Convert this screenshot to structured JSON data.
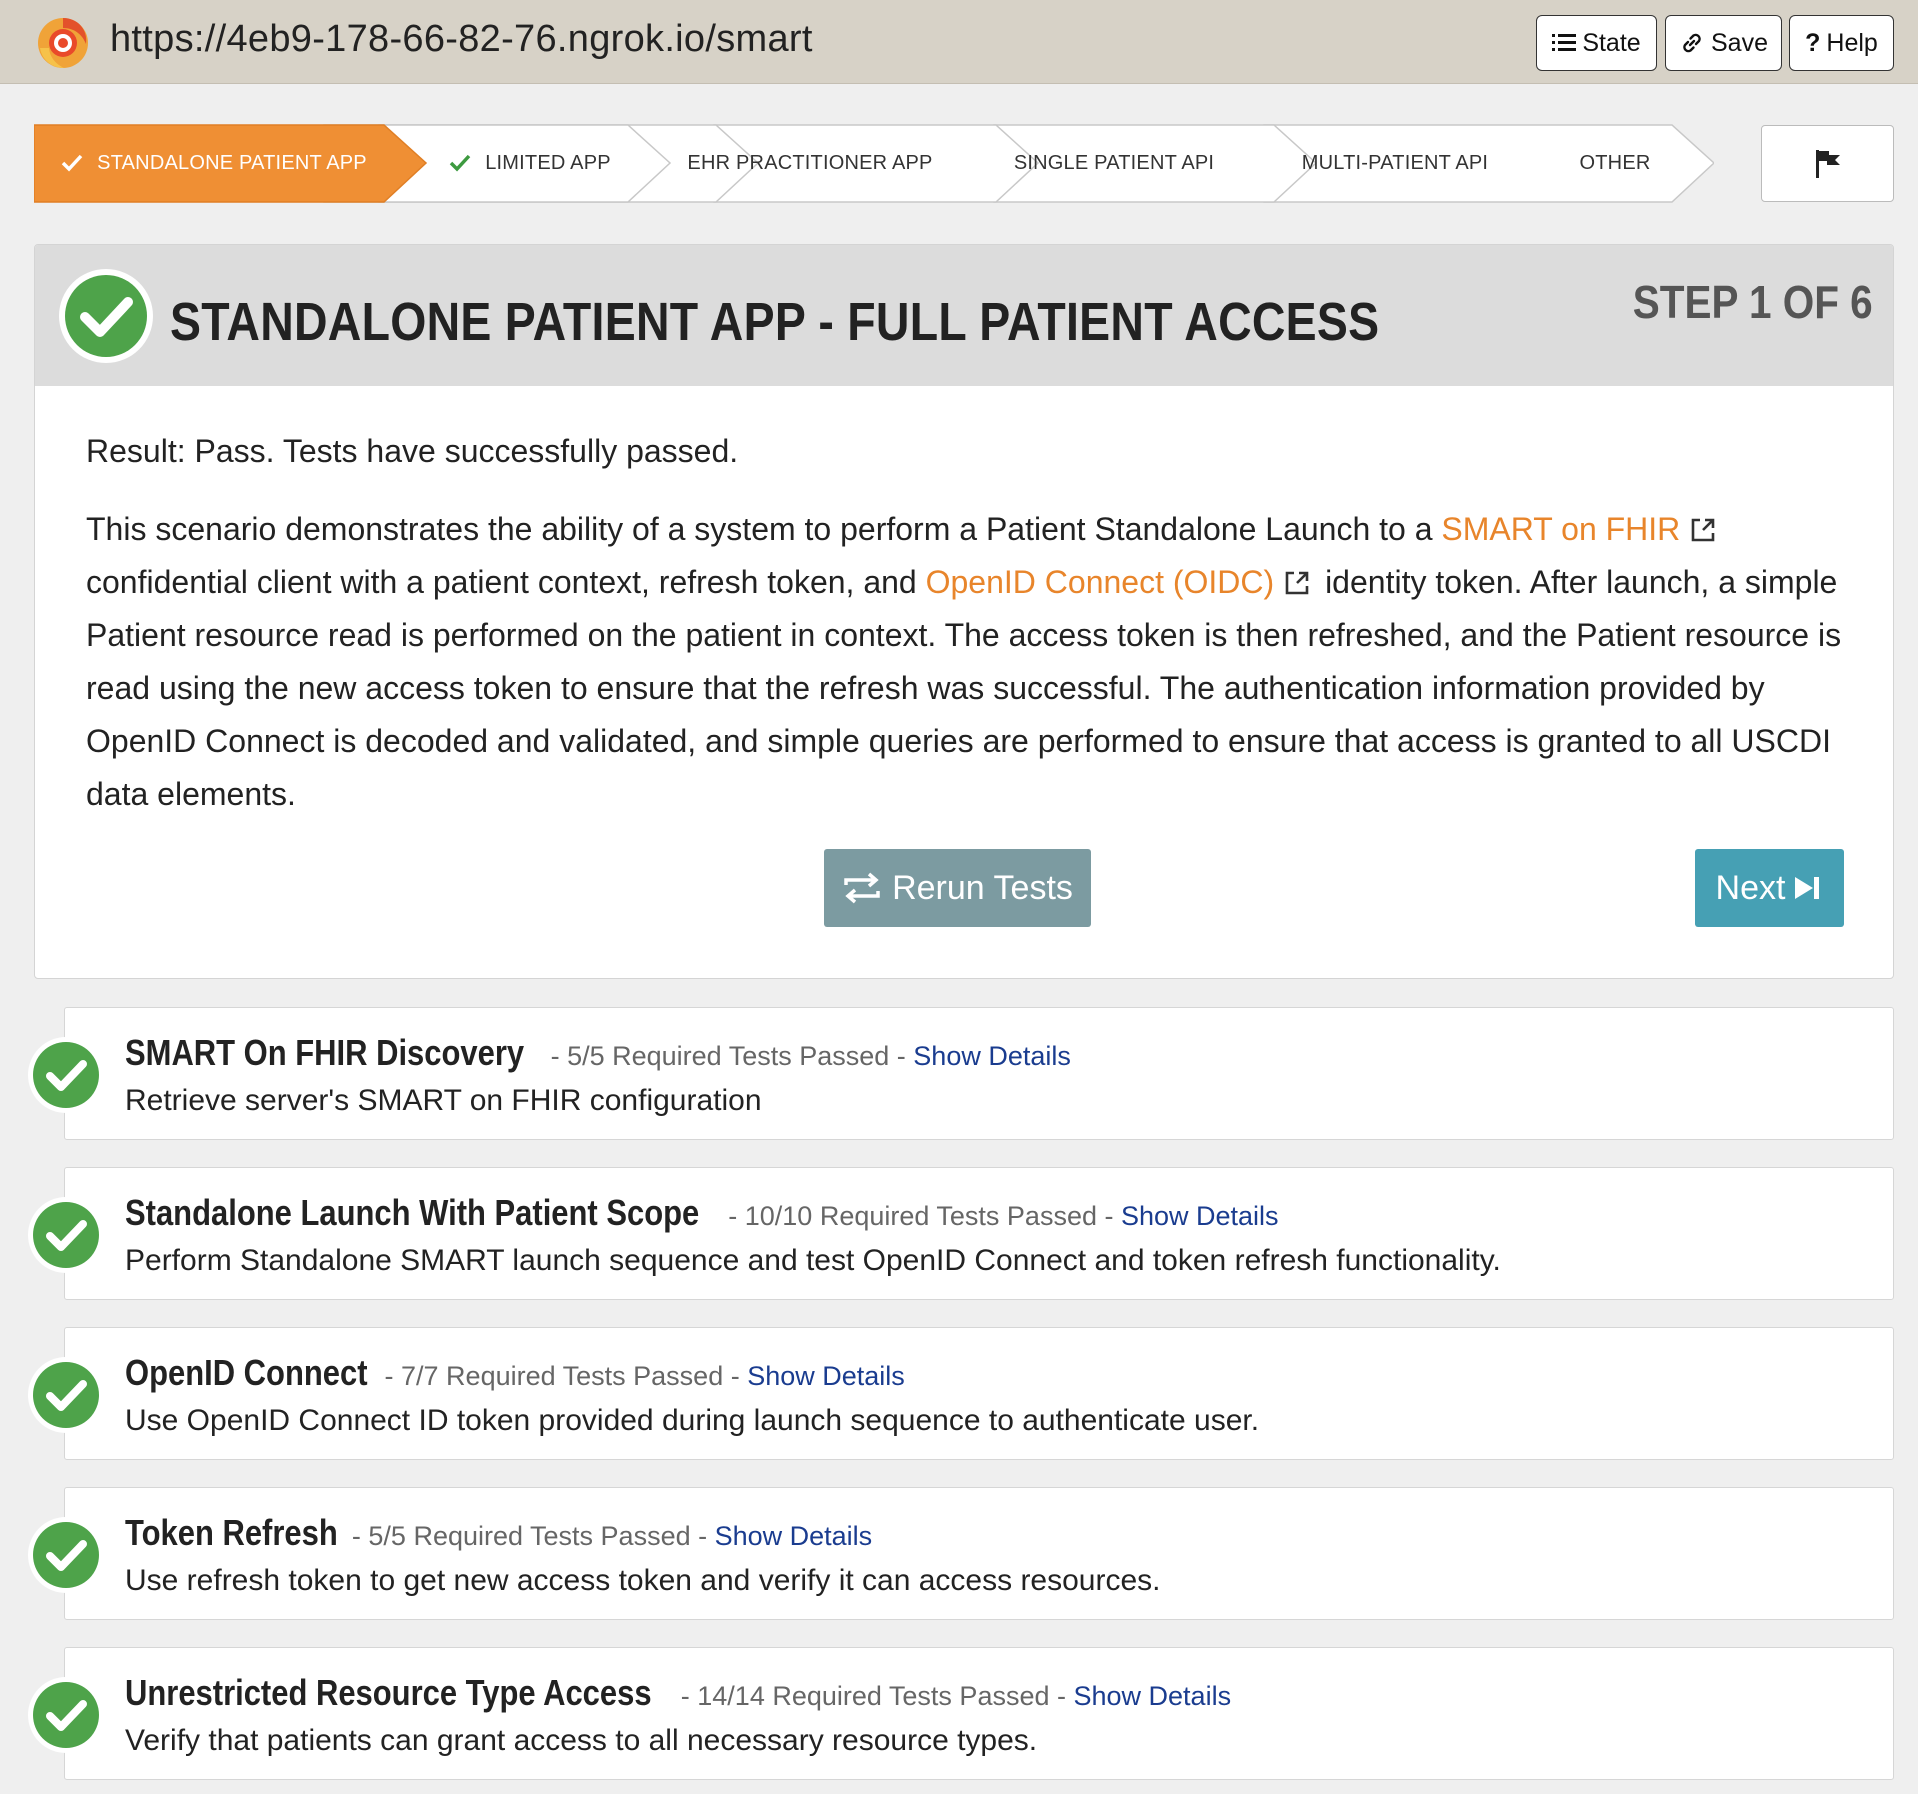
{
  "header": {
    "url": "https://4eb9-178-66-82-76.ngrok.io/smart",
    "buttons": {
      "state": "State",
      "save": "Save",
      "help": "Help"
    }
  },
  "steps": [
    {
      "label": "STANDALONE PATIENT APP",
      "active": true,
      "passed": true
    },
    {
      "label": "LIMITED APP",
      "active": false,
      "passed": true
    },
    {
      "label": "EHR PRACTITIONER APP",
      "active": false,
      "passed": false
    },
    {
      "label": "SINGLE PATIENT API",
      "active": false,
      "passed": false
    },
    {
      "label": "MULTI-PATIENT API",
      "active": false,
      "passed": false
    },
    {
      "label": "OTHER",
      "active": false,
      "passed": false
    }
  ],
  "card": {
    "title": "STANDALONE PATIENT APP - FULL PATIENT ACCESS",
    "step_counter": "STEP 1 OF 6",
    "result": "Result: Pass. Tests have successfully passed.",
    "description": {
      "part1": "This scenario demonstrates the ability of a system to perform a Patient Standalone Launch to a",
      "link1": "SMART on FHIR",
      "part2": "confidential client with a patient context, refresh token, and",
      "link2": "OpenID Connect (OIDC)",
      "part3": "identity token. After launch, a simple Patient resource read is performed on the patient in context. The access token is then refreshed, and the Patient resource is read using the new access token to ensure that the refresh was successful. The authentication information provided by OpenID Connect is decoded and validated, and simple queries are performed to ensure that access is granted to all USCDI data elements."
    },
    "rerun_label": "Rerun Tests",
    "next_label": "Next"
  },
  "test_groups": [
    {
      "title": "SMART On FHIR Discovery",
      "separator": " - ",
      "passed": "5/5 Required Tests Passed",
      "details_link": "Show Details",
      "description": "Retrieve server's SMART on FHIR configuration"
    },
    {
      "title": "Standalone Launch With Patient Scope",
      "separator": " - ",
      "passed": "10/10 Required Tests Passed",
      "details_link": "Show Details",
      "description": "Perform Standalone SMART launch sequence and test OpenID Connect and token refresh functionality."
    },
    {
      "title": "OpenID Connect",
      "separator": " - ",
      "passed": "7/7 Required Tests Passed",
      "details_link": "Show Details",
      "description": "Use OpenID Connect ID token provided during launch sequence to authenticate user."
    },
    {
      "title": "Token Refresh",
      "separator": " - ",
      "passed": "5/5 Required Tests Passed",
      "details_link": "Show Details",
      "description": "Use refresh token to get new access token and verify it can access resources."
    },
    {
      "title": "Unrestricted Resource Type Access",
      "separator": " - ",
      "passed": "14/14 Required Tests Passed",
      "details_link": "Show Details",
      "description": "Verify that patients can grant access to all necessary resource types."
    }
  ],
  "colors": {
    "accent_orange": "#ef8f34",
    "pass_green": "#4ea34a",
    "link_blue": "#1a3c8f",
    "rerun_gray": "#7c9ba1",
    "next_teal": "#46a0b4"
  }
}
